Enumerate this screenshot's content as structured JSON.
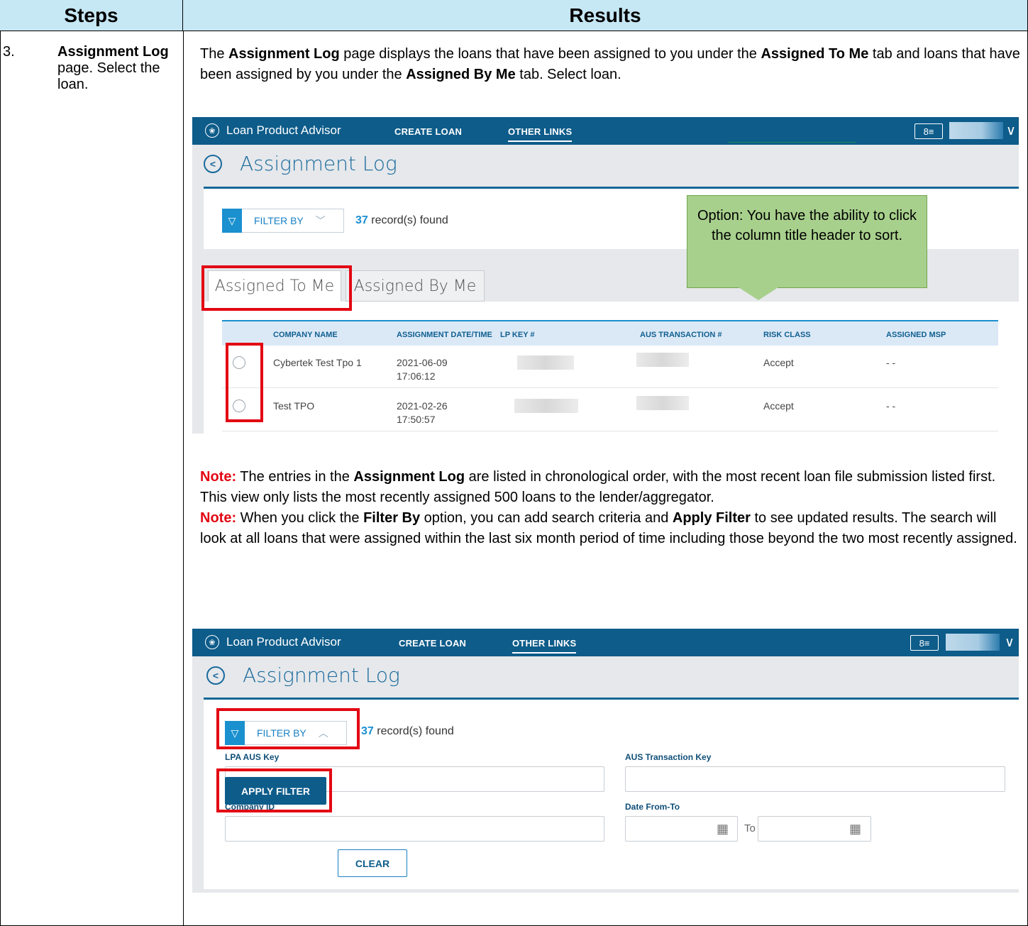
{
  "table_headers": {
    "steps": "Steps",
    "results": "Results"
  },
  "step": {
    "number": "3.",
    "title_bold": "Assignment Log",
    "text_after": " page. Select the loan."
  },
  "intro": {
    "p1": "The ",
    "b1": "Assignment Log",
    "p2": " page displays the loans that have been assigned to you under the ",
    "b2": "Assigned To Me",
    "p3": " tab and loans that have been assigned by you under the ",
    "b3": "Assigned By Me",
    "p4": " tab. Select loan."
  },
  "app": {
    "brand": "Loan Product Advisor",
    "brand_icon": "loan-product-advisor-logo",
    "nav_create": "CREATE LOAN",
    "nav_other": "OTHER LINKS",
    "user_icon": "user-card-icon",
    "chevron": "∨",
    "page_title": "Assignment Log",
    "filter_label": "FILTER BY",
    "records_count": "37",
    "records_text": " record(s) found"
  },
  "callout": "Option: You have the ability to click the column title header to sort.",
  "tabs": {
    "assigned_to_me": "Assigned To Me",
    "assigned_by_me": "Assigned By Me"
  },
  "columns": [
    "COMPANY NAME",
    "ASSIGNMENT DATE/TIME",
    "LP KEY #",
    "AUS TRANSACTION #",
    "RISK CLASS",
    "ASSIGNED MSP"
  ],
  "rows": [
    {
      "company": "Cybertek Test Tpo 1",
      "date": "2021-06-09",
      "time": "17:06:12",
      "risk": "Accept",
      "msp": "- -"
    },
    {
      "company": "Test TPO",
      "date": "2021-02-26",
      "time": "17:50:57",
      "risk": "Accept",
      "msp": "- -"
    }
  ],
  "note1": {
    "label": "Note:",
    "t1": "  The entries in the ",
    "b1": "Assignment Log",
    "t2": " are listed in chronological order, with the most recent loan file submission listed first. This view only lists the most recently assigned 500 loans to the lender/aggregator."
  },
  "note2": {
    "label": "Note:",
    "t1": " When you click the ",
    "b1": "Filter By",
    "t2": " option, you can add search criteria and ",
    "b2": "Apply Filter",
    "t3": " to see updated results. The search will look at all loans that were assigned within the last six month period of time including those beyond the two most recently assigned."
  },
  "filter_form": {
    "lpa_aus_key": "LPA AUS Key",
    "aus_transaction_key": "AUS Transaction Key",
    "company_id": "Company ID",
    "date_from_to": "Date From-To",
    "to": "To",
    "apply": "APPLY FILTER",
    "clear": "CLEAR"
  },
  "colors": {
    "header_bg": "#c6e7f4",
    "app_blue": "#0d5c8a",
    "highlight_red": "#e30613",
    "callout_green": "#a8d08d"
  }
}
